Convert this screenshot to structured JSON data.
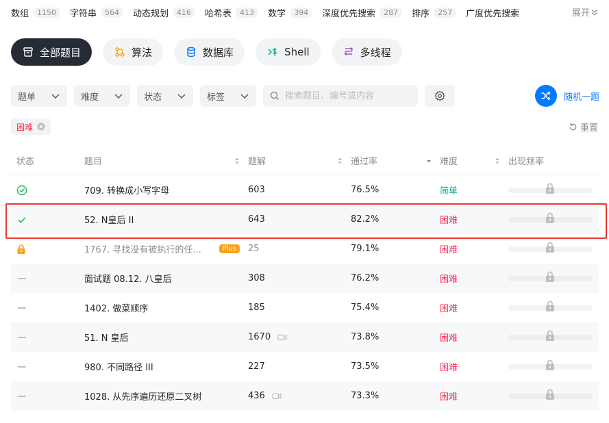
{
  "tags": [
    {
      "name": "数组",
      "count": "1150"
    },
    {
      "name": "字符串",
      "count": "564"
    },
    {
      "name": "动态规划",
      "count": "416"
    },
    {
      "name": "哈希表",
      "count": "413"
    },
    {
      "name": "数学",
      "count": "394"
    },
    {
      "name": "深度优先搜索",
      "count": "287"
    },
    {
      "name": "排序",
      "count": "257"
    },
    {
      "name": "广度优先搜索",
      "count": ""
    }
  ],
  "expand_label": "展开",
  "categories": [
    {
      "label": "全部题目",
      "icon": "inbox-icon"
    },
    {
      "label": "算法",
      "icon": "algorithm-icon"
    },
    {
      "label": "数据库",
      "icon": "database-icon"
    },
    {
      "label": "Shell",
      "icon": "shell-icon"
    },
    {
      "label": "多线程",
      "icon": "thread-icon"
    }
  ],
  "filters": {
    "list": "题单",
    "difficulty": "难度",
    "status": "状态",
    "tags": "标签",
    "search_placeholder": "搜索题目、编号或内容",
    "random_label": "随机一题"
  },
  "active_filter": {
    "label": "困难"
  },
  "reset_label": "重置",
  "columns": {
    "status": "状态",
    "title": "题目",
    "solutions": "题解",
    "rate": "通过率",
    "difficulty": "难度",
    "frequency": "出现频率"
  },
  "rows": [
    {
      "status": "solved-circle",
      "title": "709. 转换成小写字母",
      "solutions": "603",
      "rate": "76.5%",
      "difficulty": "简单",
      "video": false,
      "plus": false
    },
    {
      "status": "check",
      "title": "52. N皇后 II",
      "solutions": "643",
      "rate": "82.2%",
      "difficulty": "困难",
      "video": false,
      "plus": false
    },
    {
      "status": "lock",
      "title": "1767. 寻找没有被执行的任...",
      "solutions": "25",
      "rate": "79.1%",
      "difficulty": "困难",
      "video": false,
      "plus": true
    },
    {
      "status": "none",
      "title": "面试题 08.12. 八皇后",
      "solutions": "308",
      "rate": "76.2%",
      "difficulty": "困难",
      "video": false,
      "plus": false
    },
    {
      "status": "none",
      "title": "1402. 做菜顺序",
      "solutions": "185",
      "rate": "75.4%",
      "difficulty": "困难",
      "video": false,
      "plus": false
    },
    {
      "status": "none",
      "title": "51. N 皇后",
      "solutions": "1670",
      "rate": "73.8%",
      "difficulty": "困难",
      "video": true,
      "plus": false
    },
    {
      "status": "none",
      "title": "980. 不同路径 III",
      "solutions": "227",
      "rate": "73.5%",
      "difficulty": "困难",
      "video": false,
      "plus": false
    },
    {
      "status": "none",
      "title": "1028. 从先序遍历还原二叉树",
      "solutions": "436",
      "rate": "73.3%",
      "difficulty": "困难",
      "video": true,
      "plus": false
    }
  ],
  "plus_label": "Plus",
  "colors": {
    "accent": "#007aff",
    "easy": "#00af9b",
    "hard": "#ff2d55",
    "highlight": "#e53935"
  }
}
